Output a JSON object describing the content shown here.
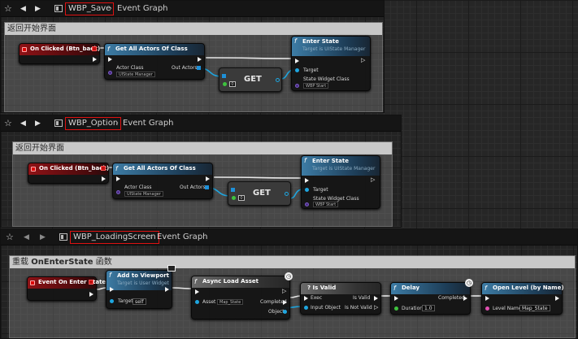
{
  "panels": [
    {
      "tab_label": "WBP_Save",
      "graph_label": "Event Graph",
      "comment": "返回开始界面",
      "event_node": "On Clicked (Btn_back)",
      "actors_node": "Get All Actors Of Class",
      "actor_class_label": "Actor Class",
      "actor_class_value": "UIState Manager",
      "out_actors_label": "Out Actors",
      "get_label": "GET",
      "get_index": "0",
      "enter_node": "Enter State",
      "enter_sub": "Target is UIState Manager",
      "target_label": "Target",
      "widget_class_label": "State Widget Class",
      "widget_class_value": "WBP Start"
    },
    {
      "tab_label": "WBP_Option",
      "graph_label": "Event Graph",
      "comment": "返回开始界面",
      "event_node": "On Clicked (Btn_back)",
      "actors_node": "Get All Actors Of Class",
      "actor_class_label": "Actor Class",
      "actor_class_value": "UIState Manager",
      "out_actors_label": "Out Actors",
      "get_label": "GET",
      "get_index": "0",
      "enter_node": "Enter State",
      "enter_sub": "Target is UIState Manager",
      "target_label": "Target",
      "widget_class_label": "State Widget Class",
      "widget_class_value": "WBP Start"
    }
  ],
  "loading": {
    "tab_label": "WBP_LoadingScreen",
    "graph_label": "Event Graph",
    "comment_prefix": "重载 ",
    "comment_bold": "OnEnterState",
    "comment_suffix": " 函数",
    "event_node": "Event On Enter State",
    "viewport_node": "Add to Viewport",
    "viewport_sub": "Target is User Widget",
    "target_label": "Target",
    "target_value": "self",
    "async_node": "Async Load Asset",
    "asset_label": "Asset",
    "asset_value": "Map_State",
    "completed_label": "Completed",
    "object_label": "Object",
    "isvalid_node": "? Is Valid",
    "exec_label": "Exec",
    "input_object_label": "Input Object",
    "is_valid_label": "Is Valid",
    "is_not_valid_label": "Is Not Valid",
    "delay_node": "Delay",
    "delay_completed_label": "Completed",
    "duration_label": "Duration",
    "duration_value": "1.0",
    "open_level_node": "Open Level (by Name)",
    "level_name_label": "Level Name",
    "level_name_value": "Map_State"
  },
  "colors": {
    "event_header": "#8e1216",
    "function_header": "#3d7ca5",
    "highlight_box": "#d11111",
    "object_pin": "#1ea6e0",
    "class_pin": "#4b2d86",
    "float_pin": "#3ec23e",
    "name_pin": "#e04fb1"
  }
}
